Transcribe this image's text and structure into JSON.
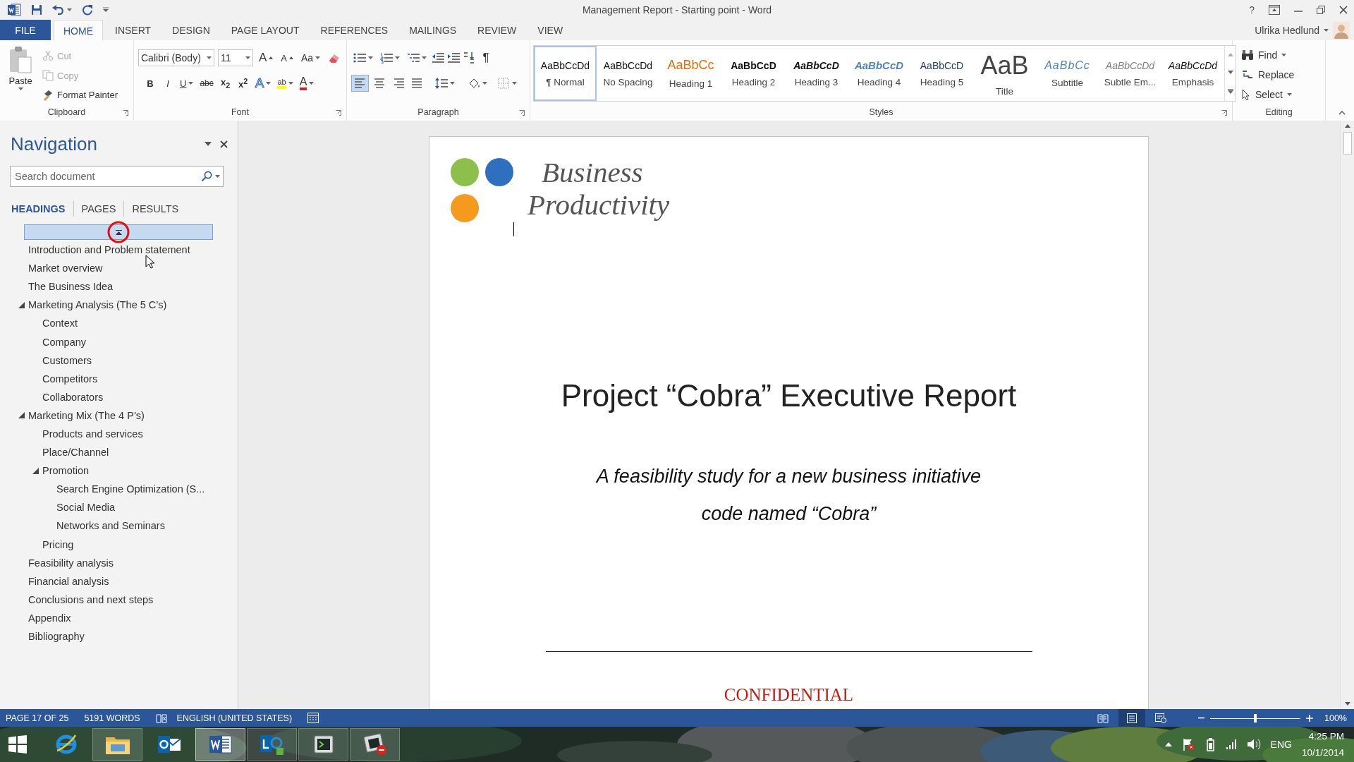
{
  "window": {
    "title": "Management Report - Starting point - Word",
    "help": "?"
  },
  "ribbon_tabs": [
    {
      "label": "FILE",
      "kind": "file",
      "selected": false
    },
    {
      "label": "HOME",
      "kind": "tab",
      "selected": true
    },
    {
      "label": "INSERT",
      "kind": "tab",
      "selected": false
    },
    {
      "label": "DESIGN",
      "kind": "tab",
      "selected": false
    },
    {
      "label": "PAGE LAYOUT",
      "kind": "tab",
      "selected": false
    },
    {
      "label": "REFERENCES",
      "kind": "tab",
      "selected": false
    },
    {
      "label": "MAILINGS",
      "kind": "tab",
      "selected": false
    },
    {
      "label": "REVIEW",
      "kind": "tab",
      "selected": false
    },
    {
      "label": "VIEW",
      "kind": "tab",
      "selected": false
    }
  ],
  "account": {
    "name": "Ulrika Hedlund"
  },
  "clipboard": {
    "label": "Clipboard",
    "paste": "Paste",
    "commands": [
      {
        "kind": "cut",
        "label": "Cut",
        "disabled": true
      },
      {
        "kind": "copy",
        "label": "Copy",
        "disabled": true
      },
      {
        "kind": "format-painter",
        "label": "Format Painter",
        "disabled": false
      }
    ]
  },
  "font": {
    "label": "Font",
    "name": "Calibri (Body)",
    "size": "11",
    "tools": [
      {
        "kind": "grow",
        "label": "A"
      },
      {
        "kind": "shrink",
        "label": "A"
      },
      {
        "kind": "case",
        "label": "Aa"
      },
      {
        "kind": "clear"
      }
    ],
    "formats": [
      {
        "kind": "bold",
        "label": "B"
      },
      {
        "kind": "italic",
        "label": "I"
      },
      {
        "kind": "underline",
        "label": "U"
      },
      {
        "kind": "strike",
        "label": "abc"
      },
      {
        "kind": "sub",
        "label": "x$_{2}$"
      },
      {
        "kind": "sup",
        "label": "x$^{2}$"
      },
      {
        "kind": "effects",
        "label": "A"
      },
      {
        "kind": "highlight",
        "label": "ab"
      },
      {
        "kind": "color",
        "label": "A"
      }
    ]
  },
  "paragraph": {
    "label": "Paragraph",
    "marks": "¶",
    "alignments": [
      {
        "selected": true
      },
      {
        "selected": false
      },
      {
        "selected": false
      },
      {
        "selected": false
      }
    ]
  },
  "styles": {
    "label": "Styles",
    "items": [
      {
        "kind": "normal",
        "sample": "AaBbCcDd",
        "label": "¶ Normal",
        "selected": true
      },
      {
        "kind": "no-spacing",
        "sample": "AaBbCcDd",
        "label": "No Spacing",
        "selected": false
      },
      {
        "kind": "heading1",
        "sample": "AaBbCc",
        "label": "Heading 1",
        "selected": false
      },
      {
        "kind": "heading2",
        "sample": "AaBbCcD",
        "label": "Heading 2",
        "selected": false
      },
      {
        "kind": "heading3",
        "sample": "AaBbCcD",
        "label": "Heading 3",
        "selected": false
      },
      {
        "kind": "heading4",
        "sample": "AaBbCcD",
        "label": "Heading 4",
        "selected": false
      },
      {
        "kind": "heading5",
        "sample": "AaBbCcD",
        "label": "Heading 5",
        "selected": false
      },
      {
        "kind": "title",
        "sample": "AaB",
        "label": "Title",
        "selected": false
      },
      {
        "kind": "subtitle",
        "sample": "AaBbCc",
        "label": "Subtitle",
        "selected": false
      },
      {
        "kind": "subtle-emphasis",
        "sample": "AaBbCcDd",
        "label": "Subtle Em...",
        "selected": false
      },
      {
        "kind": "emphasis",
        "sample": "AaBbCcDd",
        "label": "Emphasis",
        "selected": false
      }
    ]
  },
  "editing": {
    "label": "Editing",
    "commands": [
      {
        "kind": "find",
        "label": "Find"
      },
      {
        "kind": "replace",
        "label": "Replace"
      },
      {
        "kind": "select",
        "label": "Select"
      }
    ]
  },
  "navigation": {
    "title": "Navigation",
    "search": {
      "placeholder": "Search document"
    },
    "tabs": [
      {
        "label": "HEADINGS",
        "selected": true
      },
      {
        "label": "PAGES",
        "selected": false
      },
      {
        "label": "RESULTS",
        "selected": false
      }
    ],
    "top_bar": {
      "selected": true
    },
    "headings": [
      {
        "label": "Introduction and Problem statement",
        "selected": false
      },
      {
        "label": "Market overview",
        "selected": false
      },
      {
        "label": "The Business Idea",
        "selected": false
      },
      {
        "label": "Marketing Analysis (The 5 C’s)",
        "selected": false,
        "expanded": true,
        "children": [
          {
            "label": "Context",
            "selected": false
          },
          {
            "label": "Company",
            "selected": false
          },
          {
            "label": "Customers",
            "selected": false
          },
          {
            "label": "Competitors",
            "selected": false
          },
          {
            "label": "Collaborators",
            "selected": false
          }
        ]
      },
      {
        "label": "Marketing Mix (The 4 P’s)",
        "selected": false,
        "expanded": true,
        "children": [
          {
            "label": "Products and services",
            "selected": false
          },
          {
            "label": "Place/Channel",
            "selected": false
          },
          {
            "label": "Promotion",
            "selected": false,
            "expanded": true,
            "children": [
              {
                "label": "Search Engine Optimization (S...",
                "selected": false
              },
              {
                "label": "Social Media",
                "selected": false
              },
              {
                "label": "Networks and Seminars",
                "selected": false
              }
            ]
          },
          {
            "label": "Pricing",
            "selected": false
          }
        ]
      },
      {
        "label": "Feasibility analysis",
        "selected": false
      },
      {
        "label": "Financial analysis",
        "selected": false
      },
      {
        "label": "Conclusions and next steps",
        "selected": false
      },
      {
        "label": "Appendix",
        "selected": false
      },
      {
        "label": "Bibliography",
        "selected": false
      }
    ]
  },
  "document": {
    "logo": [
      "Business",
      "Productivity"
    ],
    "title": "Project “Cobra” Executive Report",
    "subtitle": [
      "A feasibility study for a new business initiative",
      "code named “Cobra”"
    ],
    "confidential": "CONFIDENTIAL"
  },
  "status_bar": {
    "page": "PAGE 17 OF 25",
    "words": "5191 WORDS",
    "language": "ENGLISH (UNITED STATES)",
    "views": [
      {
        "kind": "read",
        "selected": false
      },
      {
        "kind": "print",
        "selected": true
      },
      {
        "kind": "web",
        "selected": false
      }
    ],
    "zoom": {
      "level": 0.5,
      "reading": "100%"
    }
  },
  "taskbar": {
    "apps": [
      {
        "kind": "ie",
        "running": false,
        "active": false
      },
      {
        "kind": "explorer",
        "running": true,
        "active": false
      },
      {
        "kind": "outlook",
        "running": false,
        "active": false
      },
      {
        "kind": "word",
        "running": true,
        "active": true
      },
      {
        "kind": "lync",
        "running": true,
        "active": false
      },
      {
        "kind": "console",
        "running": true,
        "active": false
      },
      {
        "kind": "console-stop",
        "running": true,
        "active": false
      }
    ],
    "language": "ENG",
    "time": "4:25 PM",
    "date": "10/1/2014"
  }
}
